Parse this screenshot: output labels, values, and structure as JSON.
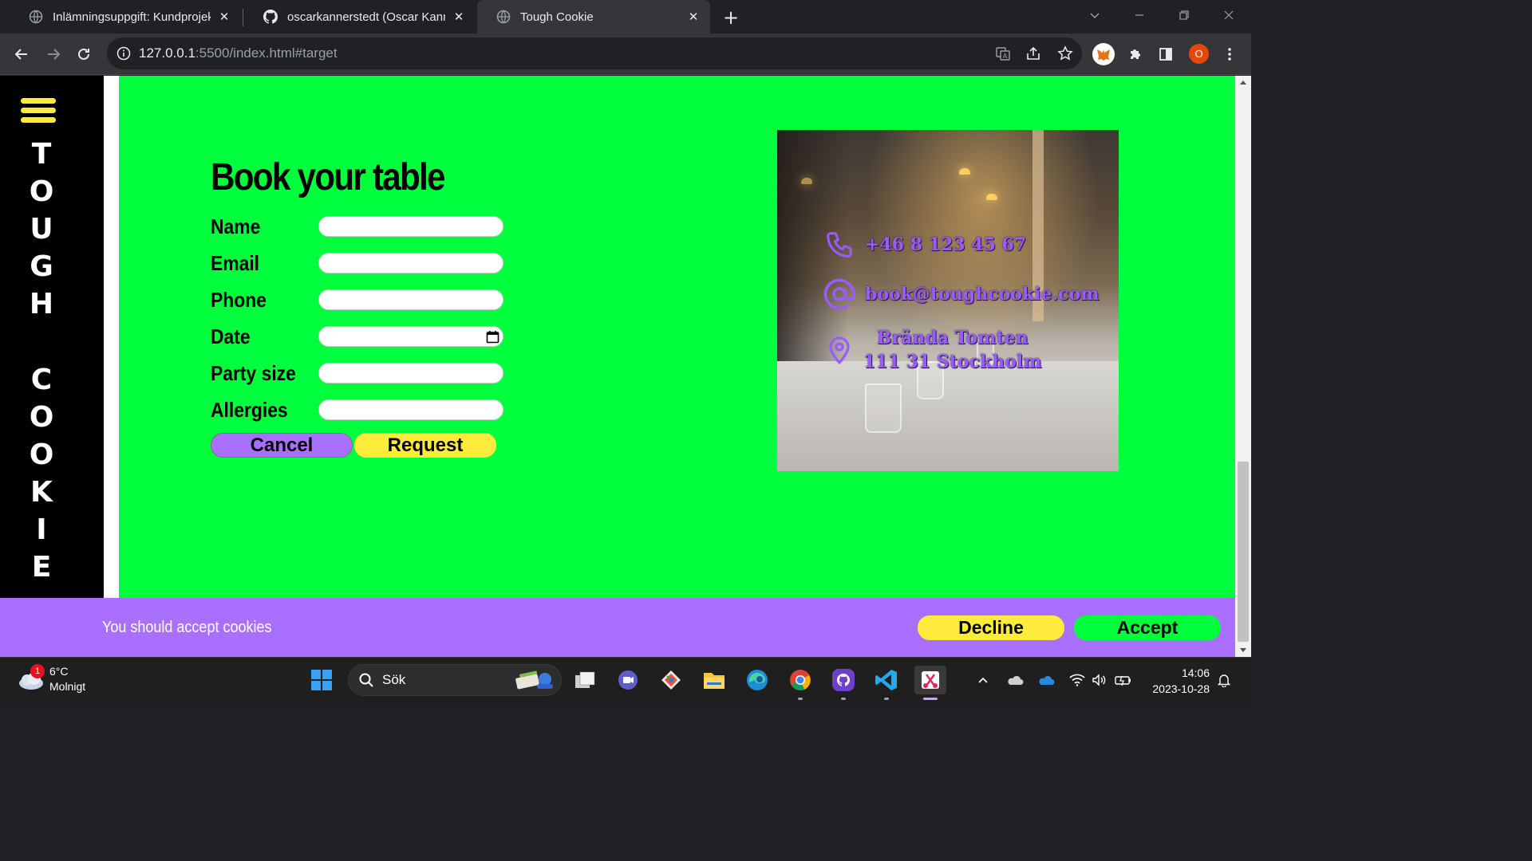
{
  "browser": {
    "tabs": [
      {
        "title": "Inlämningsuppgift: Kundprojekt",
        "icon": "globe-icon"
      },
      {
        "title": "oscarkannerstedt (Oscar Kannerstedt)",
        "icon": "github-icon"
      },
      {
        "title": "Tough Cookie",
        "icon": "globe-icon"
      }
    ],
    "url_host": "127.0.0.1",
    "url_rest": ":5500/index.html#target",
    "profile_initial": "O"
  },
  "sidebar": {
    "word1": [
      "T",
      "O",
      "U",
      "G",
      "H"
    ],
    "word2": [
      "C",
      "O",
      "O",
      "K",
      "I",
      "E"
    ]
  },
  "booking": {
    "title": "Book your table",
    "fields": [
      {
        "label": "Name",
        "value": ""
      },
      {
        "label": "Email",
        "value": ""
      },
      {
        "label": "Phone",
        "value": ""
      },
      {
        "label": "Date",
        "value": ""
      },
      {
        "label": "Party size",
        "value": ""
      },
      {
        "label": "Allergies",
        "value": ""
      }
    ],
    "cancel_label": "Cancel",
    "request_label": "Request"
  },
  "contact": {
    "phone": "+46 8 123 45 67",
    "email": "book@toughcookie.com",
    "address_line1": "Brända Tomten",
    "address_line2": "111 31 Stockholm"
  },
  "cookie_banner": {
    "text": "You should accept cookies",
    "decline_label": "Decline",
    "accept_label": "Accept"
  },
  "taskbar": {
    "weather_temp": "6°C",
    "weather_desc": "Molnigt",
    "weather_badge": "1",
    "search_label": "Sök",
    "time": "14:06",
    "date": "2023-10-28"
  },
  "colors": {
    "page_green": "#00ff3c",
    "accent_purple": "#a970ff",
    "accent_yellow": "#ffeb3b"
  }
}
